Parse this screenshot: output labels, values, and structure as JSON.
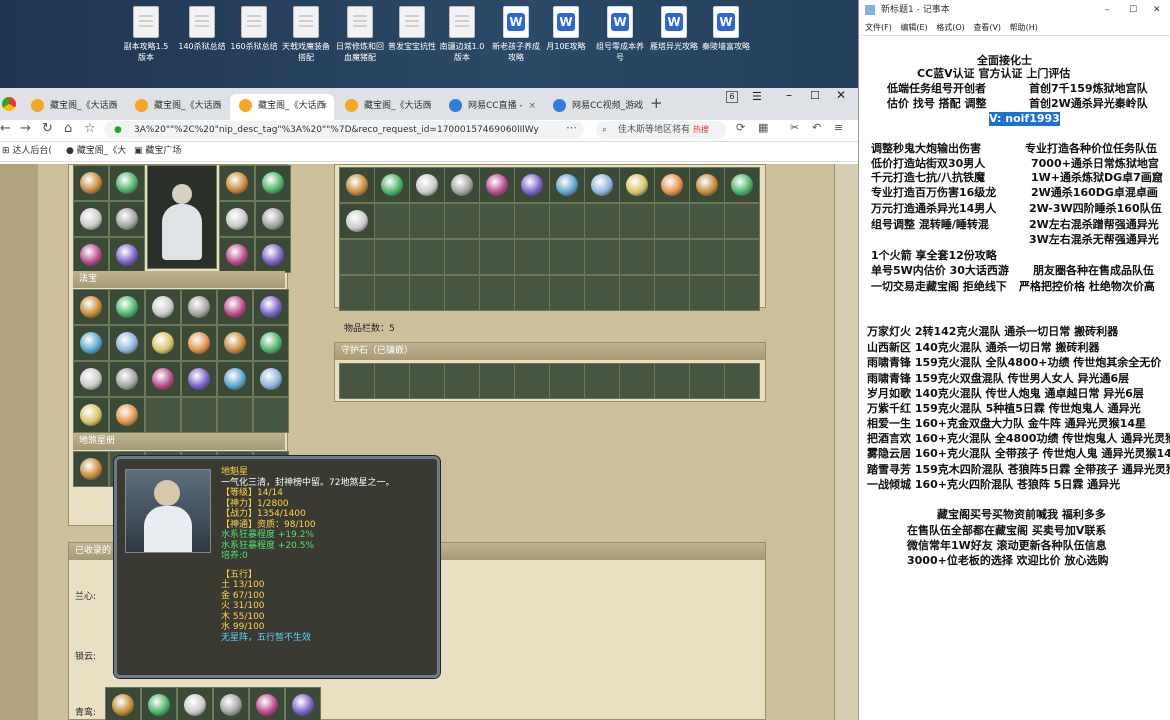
{
  "desktop": {
    "icons": [
      {
        "label": "副本攻略1.5版本",
        "type": "doc"
      },
      {
        "label": "140杀狱总结",
        "type": "doc"
      },
      {
        "label": "160杀狱总结",
        "type": "doc"
      },
      {
        "label": "天戟戏魔装备搭配",
        "type": "doc"
      },
      {
        "label": "日常修炼和回血魔猪配",
        "type": "doc"
      },
      {
        "label": "普发宝宝抗性",
        "type": "doc"
      },
      {
        "label": "南疆边城1.0版本",
        "type": "doc"
      },
      {
        "label": "新老孩子养成攻略",
        "type": "wps"
      },
      {
        "label": "月10E攻略",
        "type": "wps"
      },
      {
        "label": "组号零成本养号",
        "type": "wps"
      },
      {
        "label": "雁塔异光攻略",
        "type": "wps"
      },
      {
        "label": "秦陵墙富攻略",
        "type": "wps"
      }
    ]
  },
  "browser": {
    "tabs": [
      "藏宝阁_《大话西",
      "藏宝阁_《大话西",
      "藏宝阁_《大话西",
      "藏宝阁_《大话西",
      "网易CC直播 - ",
      "网易CC视频_游戏"
    ],
    "tab_count": "6",
    "url": "3A%20\"\"%2C%20\"nip_desc_tag\"%3A%20\"\"%7D&reco_request_id=17000157469060lIlWy",
    "search_text": "佳木斯等地区将有",
    "search_hot": "热搜",
    "bookmarks": [
      "达人后台(",
      "藏宝阁_《大",
      "藏宝广场"
    ]
  },
  "game": {
    "section_fabao": "法宝",
    "section_disha": "地煞星册",
    "section_shoucang": "已收录的",
    "items_count_label": "物品栏数：5",
    "guardian_header": "守护石（已镶嵌）",
    "side_labels": [
      "兰心:",
      "锁云:",
      "青鸾:"
    ],
    "tooltip": {
      "name": "地魁星",
      "desc": "一气化三清，封神榜中留。72地煞星之一。",
      "level": "【等级】14/14",
      "shenli": "【神力】1/2800",
      "zhanli": "【战力】1354/1400",
      "shentong": "【神通】资质：98/100",
      "water1": "水系狂暴程度 +19.2%",
      "water2": "水系狂暴程度 +20.5%",
      "peiyang": "培养:0",
      "wuxing_title": "【五行】",
      "earth": "土 13/100",
      "metal": "金 67/100",
      "fire": "火 31/100",
      "wood": "木 55/100",
      "waterv": "水 99/100",
      "note": "无星阵，五行暂不生效"
    }
  },
  "notepad": {
    "title": "新标题1 - 记事本",
    "menu": [
      "文件(F)",
      "编辑(E)",
      "格式(O)",
      "查看(V)",
      "帮助(H)"
    ],
    "lines": [
      "全面接化士",
      "CC蓝V认证 官方认证 上门评估",
      "低端任务组号开创者",
      "估价 找号 搭配 调整",
      "首创7千159炼狱地宫队",
      "首创2W通杀异光秦岭队",
      "V: noif1993",
      "调整秒鬼大炮输出伤害",
      "低价打造站街双30男人",
      "千元打造七抗/八抗铁魔",
      "专业打造百万伤害16级龙",
      "万元打造通杀异光14男人",
      "组号调整 混转睡/睡转混",
      "专业打造各种价位任务队伍",
      "7000+通杀日常炼狱地宫",
      "1W+通杀炼狱DG卓7画窟",
      "2W通杀160DG卓混卓画",
      "2W-3W四阶睡杀160队伍",
      "2W左右混杀蹭帮强通异光",
      "3W左右混杀无帮强通异光",
      "1个火箭 享全套12份攻略",
      "单号5W内估价 30大话西游",
      "一切交易走藏宝阁 拒绝线下",
      "朋友圈各种在售成品队伍",
      "严格把控价格 杜绝物次价高",
      "万家灯火 2转142克火混队 通杀一切日常 搬砖利器",
      "山西新区 140克火混队 通杀一切日常 搬砖利器",
      "雨啸青锋 159克火混队 全队4800+功绩 传世炮其余全无价",
      "雨啸青锋 159克火双盘混队 传世男人女人 异光通6层",
      "岁月如歌 140克火混队 传世人炮鬼 通卓越日常 异光6层",
      "万紫千红 159克火混队 5种植5日霖 传世炮鬼人 通异光",
      "相爱一生 160+克金双盘大力队 金牛阵 通异光灵猴14星",
      "把酒言欢 160+克火混队 全4800功绩 传世炮鬼人 通异光灵猴",
      "雾隐云居 160+克火混队 全带孩子 传世炮人鬼 通异光灵猴14",
      "踏雪寻芳 159克木四阶混队 苍狼阵5日霖 全带孩子 通异光灵猴",
      "一战倾城 160+克火四阶混队 苍狼阵 5日霖 通异光",
      "藏宝阁买号买物资前喊我 福利多多",
      "在售队伍全部都在藏宝阁 买卖号加V联系",
      "微信常年1W好友 滚动更新各种队伍信息",
      "3000+位老板的选择 欢迎比价 放心选购"
    ]
  },
  "colors": {
    "accent": "#1d6fd3",
    "game_bg": "#cdbf99",
    "tooltip_bg": "#3a3a33"
  }
}
